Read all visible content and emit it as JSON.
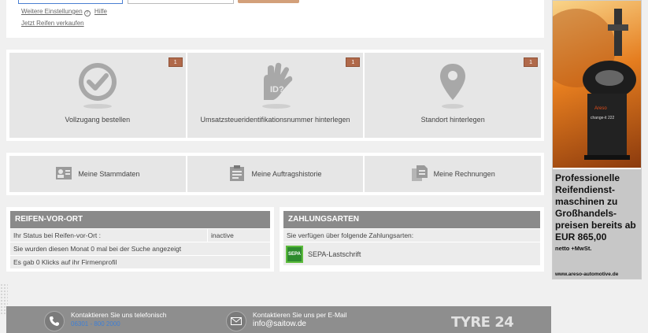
{
  "search": {
    "links": {
      "settings": "Weitere Einstellungen",
      "settings_icon": "?",
      "help": "Hilfe",
      "sell": "Jetzt Reifen verkaufen"
    }
  },
  "tiles": [
    {
      "label": "Vollzugang bestellen",
      "badge": "1",
      "icon": "checkmark-icon"
    },
    {
      "label": "Umsatzsteueridentifikationsnummer hinterlegen",
      "badge": "1",
      "icon": "id-hand-icon",
      "icon_text": "ID?"
    },
    {
      "label": "Standort hinterlegen",
      "badge": "1",
      "icon": "map-pin-icon"
    }
  ],
  "nav": [
    {
      "label": "Meine Stammdaten",
      "icon": "id-card-icon"
    },
    {
      "label": "Meine Auftragshistorie",
      "icon": "clipboard-icon"
    },
    {
      "label": "Meine Rechnungen",
      "icon": "documents-icon"
    }
  ],
  "reifen_vor_ort": {
    "title": "REIFEN-VOR-ORT",
    "rows": [
      {
        "text": "Ihr Status bei Reifen-vor-Ort :",
        "value": "inactive"
      },
      {
        "text": "Sie wurden diesen Monat 0 mal bei der Suche angezeigt"
      },
      {
        "text": "Es gab 0 Klicks auf ihr Firmenprofil"
      }
    ]
  },
  "zahlungsarten": {
    "title": "ZAHLUNGSARTEN",
    "intro": "Sie verfügen über folgende Zahlungsarten:",
    "method": "SEPA-Lastschrift",
    "method_logo": "SEPA"
  },
  "footer": {
    "phone_label": "Kontaktieren Sie uns telefonisch",
    "phone_number": "06301 - 800 2000",
    "mail_label": "Kontaktieren Sie uns per E-Mail",
    "mail": "info@saitow.de",
    "logo": "TYRE 24"
  },
  "ad": {
    "headline": "Professionelle Reifendienst-maschinen zu Großhandels-preisen bereits ab EUR 865,00",
    "sub": "netto +MwSt.",
    "url": "www.areso-automotive.de",
    "machine_brand": "Areso",
    "machine_model": "change-it 222"
  },
  "colors": {
    "badge": "#b0694a",
    "header": "#8a8a8a",
    "footer": "#8e8e8e",
    "ad_text_bg": "#c7c7c7"
  }
}
